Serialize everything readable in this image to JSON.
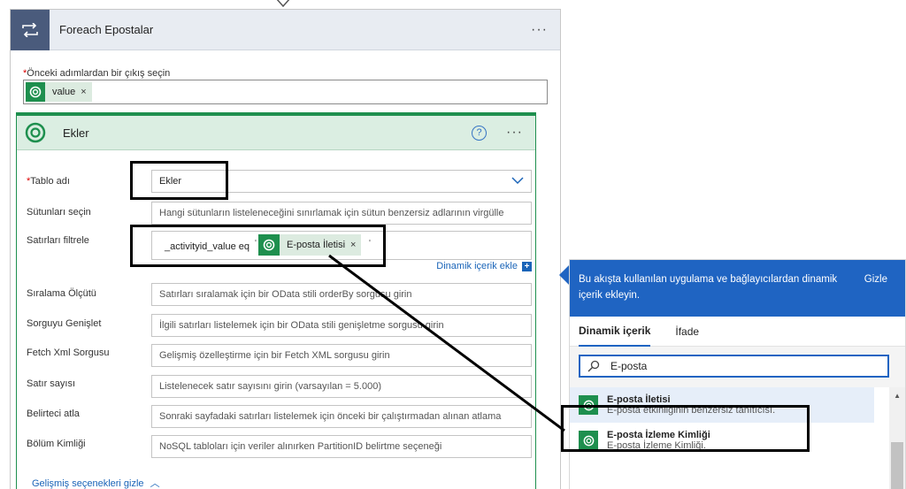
{
  "foreach": {
    "title": "Foreach Epostalar",
    "more_label": "···",
    "prev_label": "Önceki adımlardan bir çıkış seçin",
    "required_mark": "*",
    "token": {
      "label": "value",
      "remove": "×"
    }
  },
  "ekler": {
    "title": "Ekler",
    "help": "?",
    "more_label": "···",
    "rows": {
      "table_name": {
        "label": "Tablo adı",
        "value": "Ekler"
      },
      "select_columns": {
        "label": "Sütunları seçin",
        "placeholder": "Hangi sütunların listeleneceğini sınırlamak için sütun benzersiz adlarının virgülle"
      },
      "filter_rows": {
        "label": "Satırları filtrele",
        "text": "_activityid_value eq",
        "tick_open": "'",
        "tick_close": "'",
        "token_label": "E-posta İletisi",
        "token_remove": "×"
      },
      "order_by": {
        "label": "Sıralama Ölçütü",
        "placeholder": "Satırları sıralamak için bir OData stili orderBy sorgusu girin"
      },
      "expand_query": {
        "label": "Sorguyu Genişlet",
        "placeholder": "İlgili satırları listelemek için bir OData stili genişletme sorgusu girin"
      },
      "fetch_xml": {
        "label": "Fetch Xml Sorgusu",
        "placeholder": "Gelişmiş özelleştirme için bir Fetch XML sorgusu girin"
      },
      "row_count": {
        "label": "Satır sayısı",
        "placeholder": "Listelenecek satır sayısını girin (varsayılan = 5.000)"
      },
      "skip_token": {
        "label": "Belirteci atla",
        "placeholder": "Sonraki sayfadaki satırları listelemek için önceki bir çalıştırmadan alınan atlama"
      },
      "partition_id": {
        "label": "Bölüm Kimliği",
        "placeholder": "NoSQL tabloları için veriler alınırken PartitionID belirtme seçeneği"
      }
    },
    "dynamic_add": "Dinamik içerik ekle",
    "dynamic_add_plus": "+",
    "advanced": "Gelişmiş seçenekleri gizle",
    "advanced_chevron": "︿"
  },
  "panel": {
    "message": "Bu akışta kullanılan uygulama ve bağlayıcılardan dinamik içerik ekleyin.",
    "hide": "Gizle",
    "tabs": [
      "Dinamik içerik",
      "İfade"
    ],
    "search_value": "E-posta",
    "scroll_up": "▲",
    "results": [
      {
        "title": "E-posta İletisi",
        "desc": "E-posta etkinliğinin benzersiz tanıtıcısı."
      },
      {
        "title": "E-posta İzleme Kimliği",
        "desc": "E-posta İzleme Kimliği."
      }
    ]
  },
  "colors": {
    "accent_blue": "#1f64c2",
    "dataverse_green": "#1e8f4e",
    "loop_header": "#4a5b7c"
  }
}
